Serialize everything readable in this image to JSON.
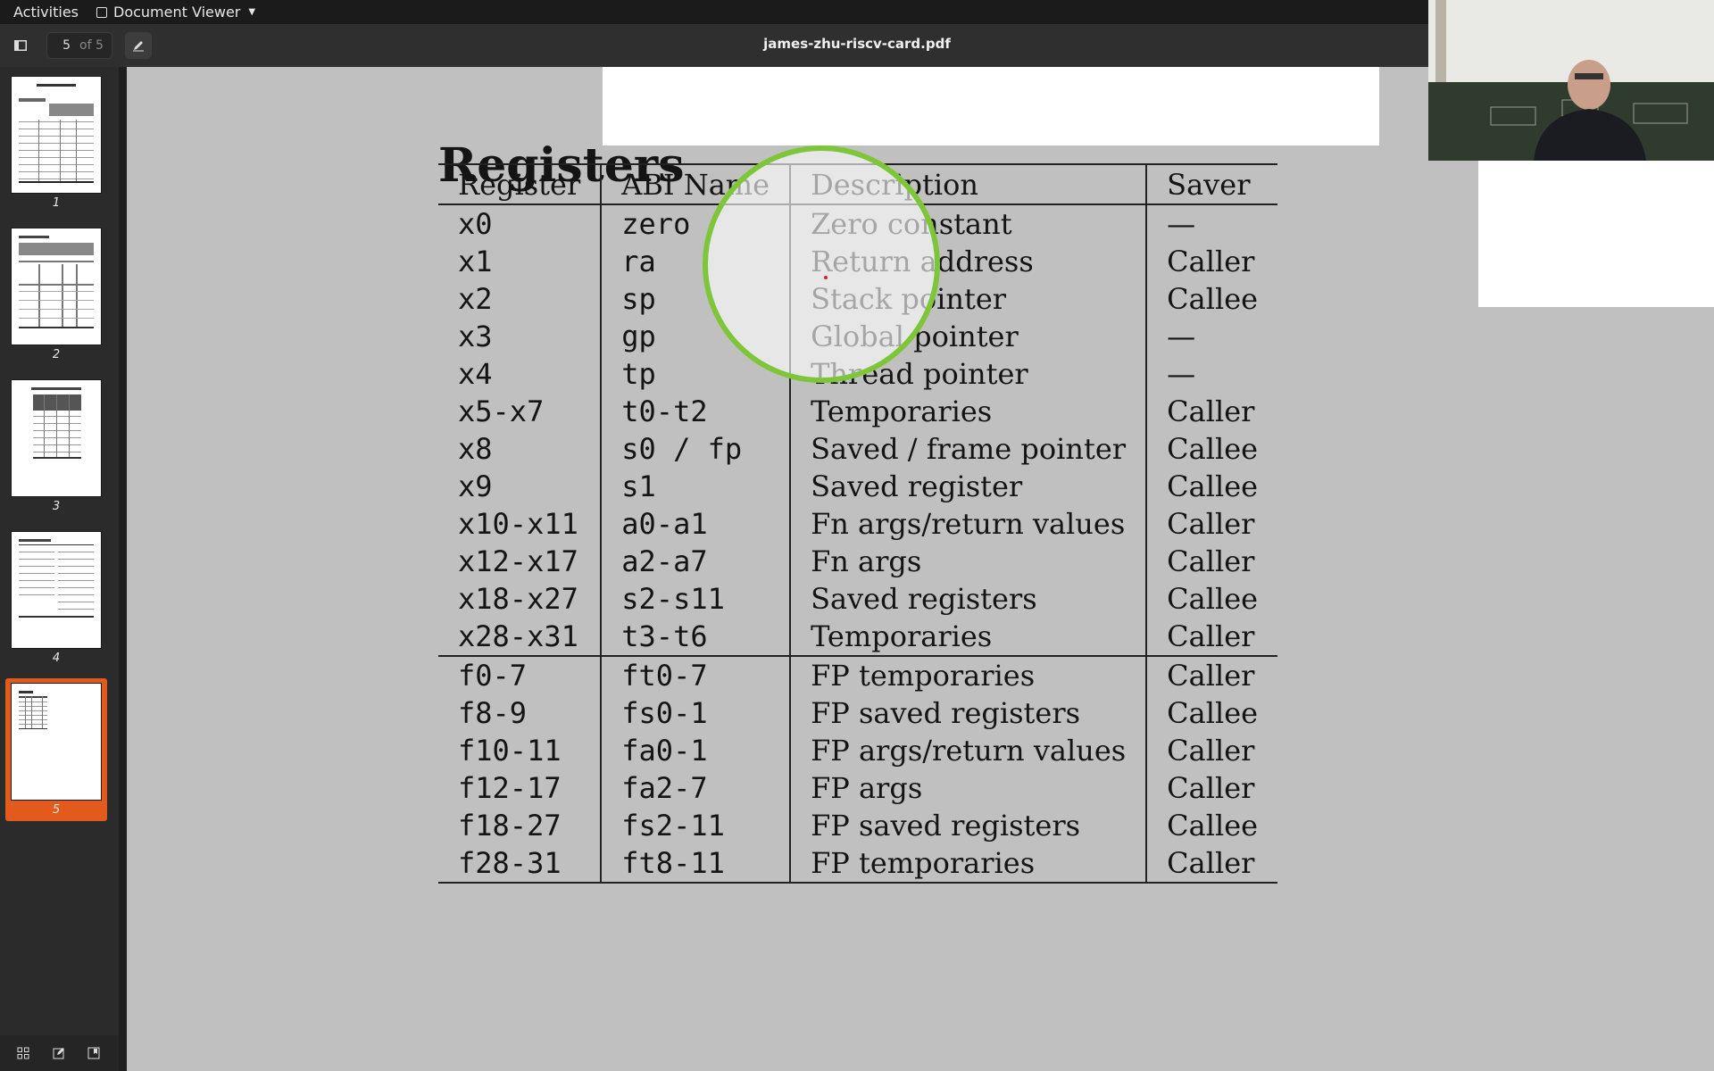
{
  "topbar": {
    "activities": "Activities",
    "app_menu": "Document Viewer"
  },
  "headerbar": {
    "page_number": "5",
    "page_total": "of 5",
    "title": "james-zhu-riscv-card.pdf"
  },
  "sidebar": {
    "thumbnails": [
      {
        "label": "1"
      },
      {
        "label": "2"
      },
      {
        "label": "3"
      },
      {
        "label": "4"
      },
      {
        "label": "5"
      }
    ],
    "selected": "5"
  },
  "document": {
    "heading": "Registers",
    "columns": [
      "Register",
      "ABI Name",
      "Description",
      "Saver"
    ],
    "rows": [
      [
        "x0",
        "zero",
        "Zero constant",
        "—"
      ],
      [
        "x1",
        "ra",
        "Return address",
        "Caller"
      ],
      [
        "x2",
        "sp",
        "Stack pointer",
        "Callee"
      ],
      [
        "x3",
        "gp",
        "Global pointer",
        "—"
      ],
      [
        "x4",
        "tp",
        "Thread pointer",
        "—"
      ],
      [
        "x5-x7",
        "t0-t2",
        "Temporaries",
        "Caller"
      ],
      [
        "x8",
        "s0 / fp",
        "Saved / frame pointer",
        "Callee"
      ],
      [
        "x9",
        "s1",
        "Saved register",
        "Callee"
      ],
      [
        "x10-x11",
        "a0-a1",
        "Fn args/return values",
        "Caller"
      ],
      [
        "x12-x17",
        "a2-a7",
        "Fn args",
        "Caller"
      ],
      [
        "x18-x27",
        "s2-s11",
        "Saved registers",
        "Callee"
      ],
      [
        "x28-x31",
        "t3-t6",
        "Temporaries",
        "Caller"
      ],
      [
        "f0-7",
        "ft0-7",
        "FP temporaries",
        "Caller"
      ],
      [
        "f8-9",
        "fs0-1",
        "FP saved registers",
        "Callee"
      ],
      [
        "f10-11",
        "fa0-1",
        "FP args/return values",
        "Caller"
      ],
      [
        "f12-17",
        "fa2-7",
        "FP args",
        "Caller"
      ],
      [
        "f18-27",
        "fs2-11",
        "FP saved registers",
        "Callee"
      ],
      [
        "f28-31",
        "ft8-11",
        "FP temporaries",
        "Caller"
      ]
    ]
  },
  "colors": {
    "selection": "#e35b1c",
    "magnifier_ring": "#7dc63a",
    "page_background": "#c0c0c0"
  }
}
